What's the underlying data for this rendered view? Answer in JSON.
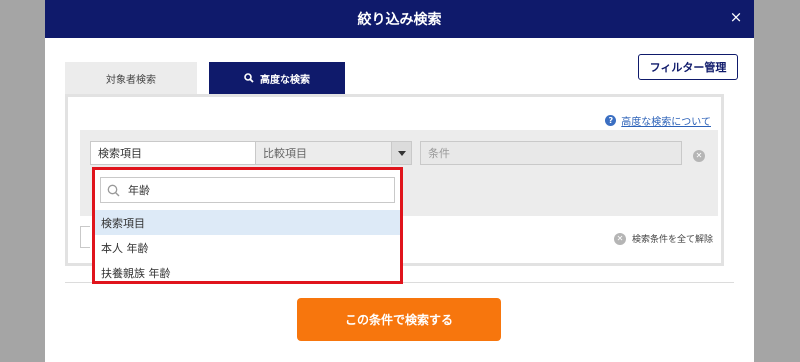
{
  "modal": {
    "title": "絞り込み検索",
    "close_label": "×"
  },
  "tabs": [
    {
      "label": "対象者検索",
      "active": false
    },
    {
      "label": "高度な検索",
      "active": true
    }
  ],
  "filter_manage_label": "フィルター管理",
  "help_link_label": "高度な検索について",
  "condition": {
    "field_select_value": "検索項目",
    "compare_select_value": "比較項目",
    "value_placeholder": "条件"
  },
  "dropdown": {
    "search_value": "年齢",
    "options": [
      "検索項目",
      "本人 年齢",
      "扶養親族 年齢"
    ],
    "selected_index": 0
  },
  "clear_all_label": "検索条件を全て解除",
  "submit_label": "この条件で検索する",
  "colors": {
    "header": "#0f1a6b",
    "submit": "#f7760d",
    "highlight_border": "#e0141c"
  }
}
